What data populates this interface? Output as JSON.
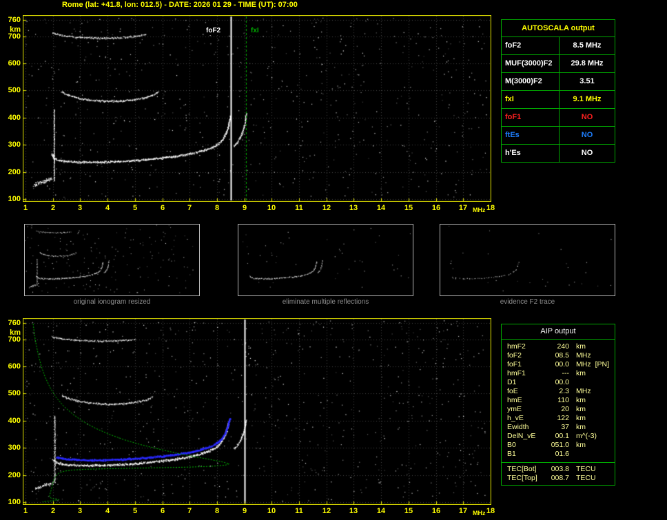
{
  "title": "Rome (lat: +41.8, lon: 012.5) - DATE: 2026 01 29 - TIME (UT): 07:00",
  "colors": {
    "accent_yellow": "#ffff00",
    "frame_green": "#00aa00",
    "trace_white": "#ffffff",
    "profile_green": "#00c000",
    "restored_blue": "#2a2aff",
    "foF1_red": "#ff2020",
    "ftEs_blue": "#1e7fff"
  },
  "autoscala_table": {
    "title": "AUTOSCALA output",
    "rows": [
      {
        "label": "foF2",
        "value": "8.5 MHz",
        "color": "#ffffff"
      },
      {
        "label": "MUF(3000)F2",
        "value": "29.8 MHz",
        "color": "#ffffff"
      },
      {
        "label": "M(3000)F2",
        "value": "3.51",
        "color": "#ffffff"
      },
      {
        "label": "fxI",
        "value": "9.1 MHz",
        "color": "#ffff00"
      },
      {
        "label": "foF1",
        "value": "NO",
        "color": "#ff2020"
      },
      {
        "label": "ftEs",
        "value": "NO",
        "color": "#1e7fff"
      },
      {
        "label": "h'Es",
        "value": "NO",
        "color": "#ffffff"
      }
    ]
  },
  "aip_table": {
    "title": "AIP output",
    "rows": [
      {
        "name": "hmF2",
        "value": "240",
        "unit": "km",
        "extra": ""
      },
      {
        "name": "foF2",
        "value": "08.5",
        "unit": "MHz",
        "extra": ""
      },
      {
        "name": "foF1",
        "value": "00.0",
        "unit": "MHz",
        "extra": "[PN]"
      },
      {
        "name": "hmF1",
        "value": "---",
        "unit": "km",
        "extra": ""
      },
      {
        "name": "D1",
        "value": "00.0",
        "unit": "",
        "extra": ""
      },
      {
        "name": "foE",
        "value": "2.3",
        "unit": "MHz",
        "extra": ""
      },
      {
        "name": "hmE",
        "value": "110",
        "unit": "km",
        "extra": ""
      },
      {
        "name": "ymE",
        "value": "20",
        "unit": "km",
        "extra": ""
      },
      {
        "name": "h_vE",
        "value": "122",
        "unit": "km",
        "extra": ""
      },
      {
        "name": "Ewidth",
        "value": "37",
        "unit": "km",
        "extra": ""
      },
      {
        "name": "DelN_vE",
        "value": "00.1",
        "unit": "m^(-3)",
        "extra": ""
      },
      {
        "name": "B0",
        "value": "051.0",
        "unit": "km",
        "extra": ""
      },
      {
        "name": "B1",
        "value": "01.6",
        "unit": "",
        "extra": ""
      }
    ],
    "tec_rows": [
      {
        "name": "TEC[Bot]",
        "value": "003.8",
        "unit": "TECU",
        "extra": ""
      },
      {
        "name": "TEC[Top]",
        "value": "008.7",
        "unit": "TECU",
        "extra": ""
      }
    ]
  },
  "thumbnails": [
    {
      "caption": "original ionogram resized",
      "traces": [
        0,
        1,
        2,
        3,
        4,
        5
      ],
      "density_scale": 0.6,
      "noise": 170
    },
    {
      "caption": "eliminate multiple reflections",
      "traces": [
        0,
        1
      ],
      "density_scale": 0.55,
      "noise": 45
    },
    {
      "caption": "evidence F2 trace",
      "traces": [
        0
      ],
      "density_scale": 0.18,
      "noise": 28
    }
  ],
  "chart_data": [
    {
      "id": "ionogram_top",
      "type": "scatter",
      "title": "",
      "xlabel": "MHz",
      "ylabel": "km",
      "xlim": [
        1,
        18
      ],
      "ylim": [
        100,
        760
      ],
      "x_ticks": [
        1,
        2,
        3,
        4,
        5,
        6,
        7,
        8,
        9,
        10,
        11,
        12,
        13,
        14,
        15,
        16,
        17,
        18
      ],
      "y_ticks": [
        760,
        700,
        600,
        500,
        400,
        300,
        200,
        100
      ],
      "grid": true,
      "seed": 11,
      "noise": 620,
      "markers": [
        {
          "label": "foF2",
          "freq": 8.5,
          "color": "#ffffff",
          "dash": false,
          "label_dx": -38
        },
        {
          "label": "fxI",
          "freq": 9.05,
          "color": "#00aa00",
          "dash": true,
          "label_dx": 5
        }
      ],
      "traces": [
        {
          "name": "F2 trace 1st hop",
          "color": "#ffffff",
          "density": 2.2,
          "thickness": 2.4,
          "size": 1.5,
          "points": [
            [
              1.95,
              268
            ],
            [
              2.05,
              250
            ],
            [
              2.2,
              244
            ],
            [
              2.5,
              240
            ],
            [
              2.9,
              238
            ],
            [
              3.4,
              237
            ],
            [
              3.9,
              238
            ],
            [
              4.4,
              240
            ],
            [
              4.9,
              243
            ],
            [
              5.4,
              247
            ],
            [
              5.9,
              252
            ],
            [
              6.4,
              258
            ],
            [
              6.9,
              266
            ],
            [
              7.3,
              275
            ],
            [
              7.7,
              287
            ],
            [
              8.0,
              302
            ],
            [
              8.2,
              320
            ],
            [
              8.33,
              345
            ],
            [
              8.42,
              375
            ],
            [
              8.48,
              408
            ]
          ]
        },
        {
          "name": "F2 trace X-mode cusp",
          "color": "#ffffff",
          "density": 2.0,
          "thickness": 2.0,
          "size": 1.4,
          "points": [
            [
              8.6,
              295
            ],
            [
              8.75,
              312
            ],
            [
              8.88,
              335
            ],
            [
              8.97,
              362
            ],
            [
              9.03,
              392
            ],
            [
              9.06,
              418
            ]
          ]
        },
        {
          "name": "F2 trace 2nd hop",
          "color": "#ffffff",
          "density": 1.7,
          "thickness": 2.2,
          "size": 1.4,
          "points": [
            [
              2.3,
              496
            ],
            [
              2.6,
              482
            ],
            [
              3.0,
              471
            ],
            [
              3.5,
              465
            ],
            [
              4.0,
              462
            ],
            [
              4.5,
              463
            ],
            [
              5.0,
              468
            ],
            [
              5.4,
              475
            ],
            [
              5.7,
              487
            ],
            [
              5.85,
              497
            ]
          ]
        },
        {
          "name": "F2 trace 3rd hop",
          "color": "#ffffff",
          "density": 1.5,
          "thickness": 2.0,
          "size": 1.3,
          "points": [
            [
              1.95,
              714
            ],
            [
              2.3,
              704
            ],
            [
              2.8,
              698
            ],
            [
              3.4,
              695
            ],
            [
              4.0,
              694
            ],
            [
              4.6,
              697
            ],
            [
              5.1,
              702
            ],
            [
              5.4,
              708
            ]
          ]
        },
        {
          "name": "interference spike 2 MHz",
          "color": "#ffffff",
          "density": 1.6,
          "thickness": 1.3,
          "size": 1.3,
          "points": [
            [
              2.04,
              165
            ],
            [
              2.04,
              300
            ],
            [
              2.04,
              432
            ]
          ]
        },
        {
          "name": "low altitude noise blob",
          "color": "#ffffff",
          "density": 2.4,
          "thickness": 4.0,
          "size": 1.5,
          "points": [
            [
              1.3,
              152
            ],
            [
              1.55,
              163
            ],
            [
              1.8,
              171
            ],
            [
              1.95,
              177
            ]
          ]
        }
      ]
    },
    {
      "id": "ionogram_bottom",
      "type": "scatter",
      "title": "",
      "xlabel": "MHz",
      "ylabel": "km",
      "xlim": [
        1,
        18
      ],
      "ylim": [
        100,
        760
      ],
      "x_ticks": [
        1,
        2,
        3,
        4,
        5,
        6,
        7,
        8,
        9,
        10,
        11,
        12,
        13,
        14,
        15,
        16,
        17,
        18
      ],
      "y_ticks": [
        760,
        700,
        600,
        500,
        400,
        300,
        200,
        100
      ],
      "grid": true,
      "seed": 23,
      "noise": 680,
      "markers": [
        {
          "label": "",
          "freq": 9.0,
          "color": "#ffffff",
          "dash": false,
          "label_dx": 0
        }
      ],
      "traces": [
        {
          "name": "F2 trace 1st hop",
          "color": "#ffffff",
          "density": 2.4,
          "thickness": 2.6,
          "size": 1.5,
          "points": [
            [
              2.0,
              258
            ],
            [
              2.15,
              246
            ],
            [
              2.4,
              240
            ],
            [
              2.8,
              237
            ],
            [
              3.3,
              236
            ],
            [
              3.8,
              237
            ],
            [
              4.3,
              239
            ],
            [
              4.8,
              242
            ],
            [
              5.3,
              246
            ],
            [
              5.8,
              251
            ],
            [
              6.3,
              257
            ],
            [
              6.8,
              264
            ],
            [
              7.2,
              273
            ],
            [
              7.6,
              285
            ],
            [
              7.9,
              299
            ],
            [
              8.1,
              316
            ],
            [
              8.25,
              340
            ],
            [
              8.35,
              368
            ],
            [
              8.43,
              400
            ]
          ]
        },
        {
          "name": "F2 trace X-mode cusp",
          "color": "#ffffff",
          "density": 1.8,
          "thickness": 2.0,
          "size": 1.4,
          "points": [
            [
              8.62,
              298
            ],
            [
              8.77,
              315
            ],
            [
              8.9,
              340
            ],
            [
              9.0,
              370
            ],
            [
              9.05,
              404
            ]
          ]
        },
        {
          "name": "F2 trace 2nd hop",
          "color": "#ffffff",
          "density": 1.6,
          "thickness": 2.2,
          "size": 1.4,
          "points": [
            [
              2.3,
              494
            ],
            [
              2.7,
              479
            ],
            [
              3.1,
              470
            ],
            [
              3.6,
              464
            ],
            [
              4.1,
              462
            ],
            [
              4.6,
              464
            ],
            [
              5.0,
              469
            ],
            [
              5.4,
              477
            ],
            [
              5.65,
              489
            ]
          ]
        },
        {
          "name": "F2 trace 3rd hop",
          "color": "#ffffff",
          "density": 1.4,
          "thickness": 2.0,
          "size": 1.3,
          "points": [
            [
              1.95,
              712
            ],
            [
              2.3,
              703
            ],
            [
              2.8,
              698
            ],
            [
              3.4,
              695
            ],
            [
              4.0,
              694
            ],
            [
              4.6,
              697
            ],
            [
              5.0,
              701
            ]
          ]
        },
        {
          "name": "interference spike 2 MHz",
          "color": "#ffffff",
          "density": 1.5,
          "thickness": 1.3,
          "size": 1.3,
          "points": [
            [
              2.06,
              170
            ],
            [
              2.06,
              300
            ],
            [
              2.06,
              420
            ]
          ]
        },
        {
          "name": "low altitude noise blob",
          "color": "#ffffff",
          "density": 2.2,
          "thickness": 3.5,
          "size": 1.4,
          "points": [
            [
              1.35,
              150
            ],
            [
              1.6,
              160
            ],
            [
              1.85,
              168
            ],
            [
              2.0,
              174
            ]
          ]
        }
      ],
      "overlays": [
        {
          "name": "restored O-trace",
          "type": "dots",
          "color": "#2a2aff",
          "density": 2.6,
          "thickness": 2.0,
          "size": 1.9,
          "points": [
            [
              2.1,
              266
            ],
            [
              2.5,
              260
            ],
            [
              3.0,
              257
            ],
            [
              3.5,
              256
            ],
            [
              4.0,
              257
            ],
            [
              4.5,
              259
            ],
            [
              5.0,
              262
            ],
            [
              5.5,
              266
            ],
            [
              6.0,
              271
            ],
            [
              6.5,
              277
            ],
            [
              7.0,
              285
            ],
            [
              7.4,
              295
            ],
            [
              7.8,
              308
            ],
            [
              8.05,
              324
            ],
            [
              8.25,
              348
            ],
            [
              8.38,
              378
            ],
            [
              8.46,
              412
            ]
          ]
        },
        {
          "name": "electron density profile",
          "type": "line",
          "color": "#00c000",
          "dash": [
            2,
            2
          ],
          "points": [
            [
              1.28,
              757
            ],
            [
              1.33,
              715
            ],
            [
              1.4,
              675
            ],
            [
              1.48,
              638
            ],
            [
              1.58,
              600
            ],
            [
              1.72,
              560
            ],
            [
              1.9,
              522
            ],
            [
              2.12,
              486
            ],
            [
              2.4,
              453
            ],
            [
              2.74,
              423
            ],
            [
              3.12,
              396
            ],
            [
              3.56,
              372
            ],
            [
              4.06,
              350
            ],
            [
              4.6,
              330
            ],
            [
              5.2,
              312
            ],
            [
              5.85,
              296
            ],
            [
              6.5,
              281
            ],
            [
              7.15,
              268
            ],
            [
              7.75,
              257
            ],
            [
              8.2,
              248
            ],
            [
              8.45,
              241
            ],
            [
              8.3,
              236
            ],
            [
              7.8,
              232
            ],
            [
              7.0,
              229
            ],
            [
              6.0,
              227
            ],
            [
              5.0,
              225
            ],
            [
              4.0,
              223
            ],
            [
              3.2,
              221
            ],
            [
              2.7,
              218
            ],
            [
              2.42,
              214
            ],
            [
              2.24,
              208
            ],
            [
              2.13,
              199
            ],
            [
              2.06,
              188
            ],
            [
              2.01,
              174
            ],
            [
              1.97,
              158
            ],
            [
              1.93,
              142
            ],
            [
              1.89,
              128
            ],
            [
              1.87,
              119
            ],
            [
              1.95,
              114
            ],
            [
              2.1,
              111
            ],
            [
              2.22,
              109
            ],
            [
              2.05,
              106
            ],
            [
              1.8,
              103
            ],
            [
              1.62,
              101
            ]
          ]
        }
      ]
    }
  ]
}
